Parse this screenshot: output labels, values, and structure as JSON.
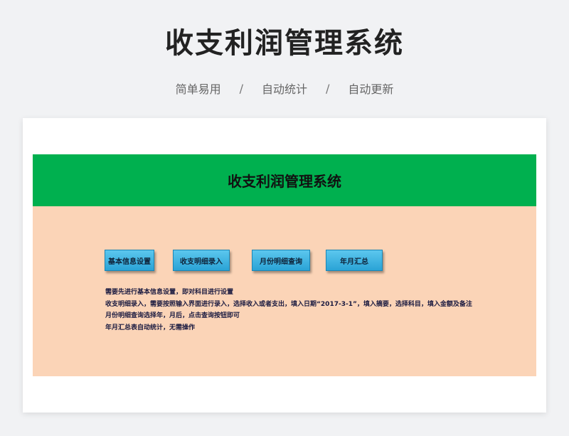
{
  "page": {
    "title": "收支利润管理系统",
    "features": [
      "简单易用",
      "自动统计",
      "自动更新"
    ],
    "separator": "/"
  },
  "sheet": {
    "header_title": "收支利润管理系统",
    "buttons": [
      {
        "label": "基本信息设置"
      },
      {
        "label": "收支明细录入"
      },
      {
        "label": "月份明细查询"
      },
      {
        "label": "年月汇总"
      }
    ],
    "notes": [
      "需要先进行基本信息设置，即对科目进行设置",
      "收支明细录入，需要按照输入界面进行录入，选择收入或者支出，填入日期“2017-3-1”，填入摘要，选择科目，填入金额及备注",
      "月份明细查询选择年，月后，点击查询按钮即可",
      "年月汇总表自动统计，无需操作"
    ]
  },
  "colors": {
    "background": "#f1f2f4",
    "header_green": "#00b04f",
    "sheet_peach": "#fbd4b7",
    "button_blue": "#2aa3d6"
  }
}
